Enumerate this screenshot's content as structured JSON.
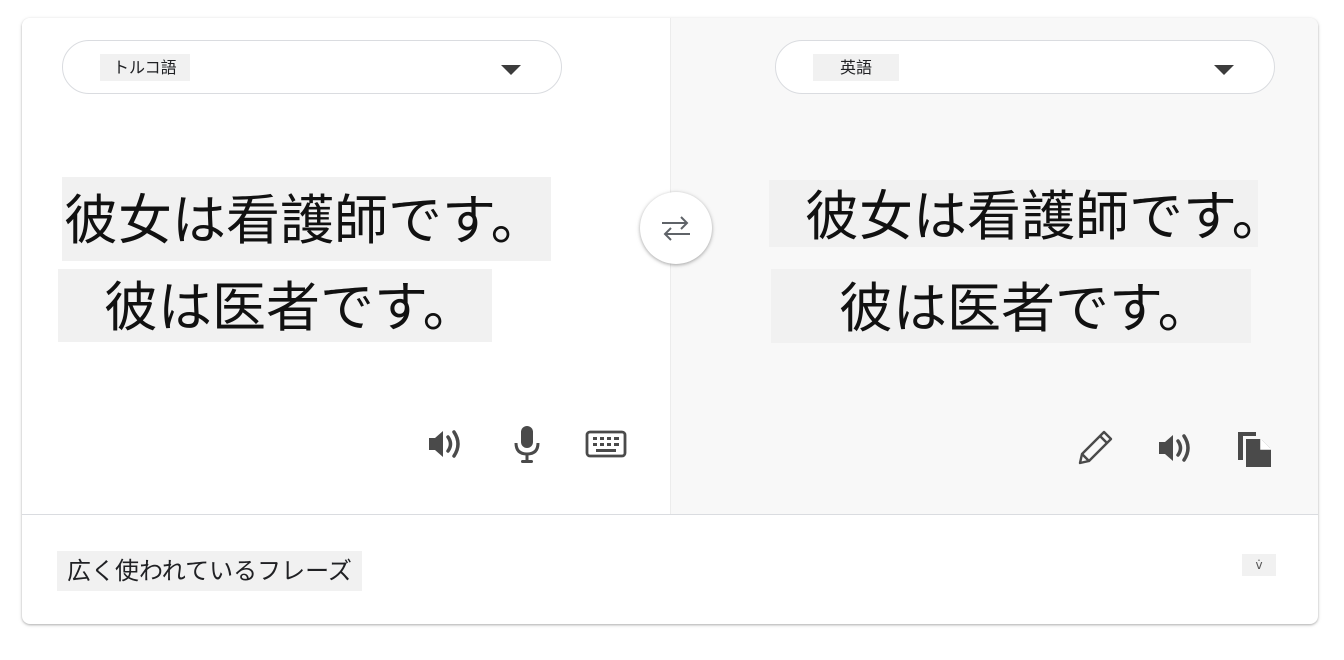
{
  "source": {
    "language_label": "トルコ語",
    "lines": [
      "彼女は看護師です。",
      "彼は医者です。"
    ]
  },
  "target": {
    "language_label": "英語",
    "lines": [
      "彼女は看護師です。",
      "彼は医者です。"
    ]
  },
  "phrases": {
    "label": "広く使われているフレーズ",
    "toggle_glyph": "v̇"
  },
  "icons": {
    "source_toolbar": [
      "speaker-icon",
      "microphone-icon",
      "keyboard-icon"
    ],
    "target_toolbar": [
      "pencil-icon",
      "speaker-icon",
      "copy-icon"
    ],
    "swap": "swap-arrows-icon",
    "dropdown": "chevron-down-icon"
  },
  "colors": {
    "highlight": "#f1f1f1",
    "icon": "#4a4a4a",
    "target_pane_bg": "#f8f8f8",
    "border": "#dadce0"
  }
}
